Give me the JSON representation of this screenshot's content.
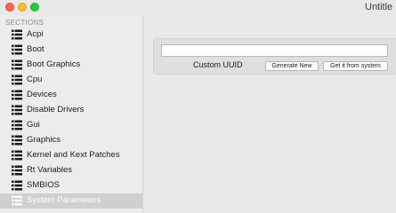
{
  "window": {
    "title": "Untitle"
  },
  "sidebar": {
    "header": "SECTIONS",
    "items": [
      {
        "label": "Acpi",
        "icon": "list-icon"
      },
      {
        "label": "Boot",
        "icon": "list-icon"
      },
      {
        "label": "Boot Graphics",
        "icon": "list-icon"
      },
      {
        "label": "Cpu",
        "icon": "list-icon"
      },
      {
        "label": "Devices",
        "icon": "list-icon"
      },
      {
        "label": "Disable Drivers",
        "icon": "list-icon"
      },
      {
        "label": "Gui",
        "icon": "list-icon"
      },
      {
        "label": "Graphics",
        "icon": "list-icon"
      },
      {
        "label": "Kernel and Kext Patches",
        "icon": "list-icon"
      },
      {
        "label": "Rt Variables",
        "icon": "list-icon"
      },
      {
        "label": "SMBIOS",
        "icon": "list-icon"
      },
      {
        "label": "System Parameters",
        "icon": "list-icon",
        "selected": true
      }
    ]
  },
  "main": {
    "uuid_value": "",
    "uuid_label": "Custom UUID",
    "generate_label": "Generate New",
    "get_from_system_label": "Get it from system"
  }
}
